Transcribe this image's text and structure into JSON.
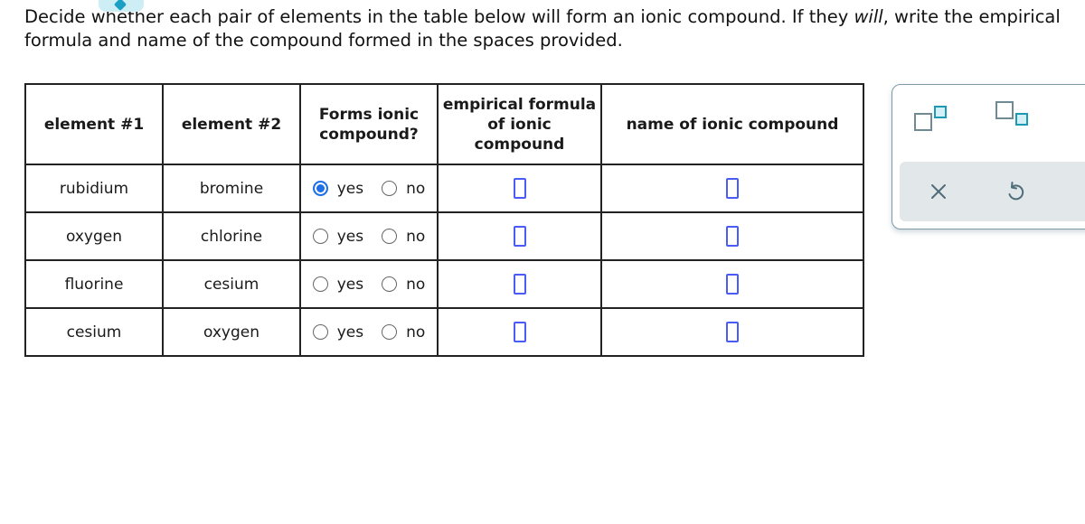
{
  "prompt": {
    "part1": "Decide whether each pair of elements in the table below will form an ionic compound. If they ",
    "emphasis": "will",
    "part2": ", write the empirical",
    "line2": "formula and name of the compound formed in the spaces provided."
  },
  "table": {
    "headers": {
      "element1": "element #1",
      "element2": "element #2",
      "forms_ionic": "Forms ionic compound?",
      "formula": "empirical formula of ionic compound",
      "name": "name of ionic compound"
    },
    "radio_labels": {
      "yes": "yes",
      "no": "no"
    },
    "rows": [
      {
        "element1": "rubidium",
        "element2": "bromine",
        "selected": "yes",
        "formula": "",
        "name": ""
      },
      {
        "element1": "oxygen",
        "element2": "chlorine",
        "selected": "",
        "formula": "",
        "name": ""
      },
      {
        "element1": "fluorine",
        "element2": "cesium",
        "selected": "",
        "formula": "",
        "name": ""
      },
      {
        "element1": "cesium",
        "element2": "oxygen",
        "selected": "",
        "formula": "",
        "name": ""
      }
    ]
  },
  "toolbar": {
    "tools": [
      "superscript-icon",
      "subscript-icon"
    ],
    "actions": [
      "clear-icon",
      "undo-icon"
    ]
  },
  "colors": {
    "selected_radio": "#1e6fe8",
    "answer_box_border": "#4a5cf5",
    "tool_accent": "#1a9ab5"
  }
}
